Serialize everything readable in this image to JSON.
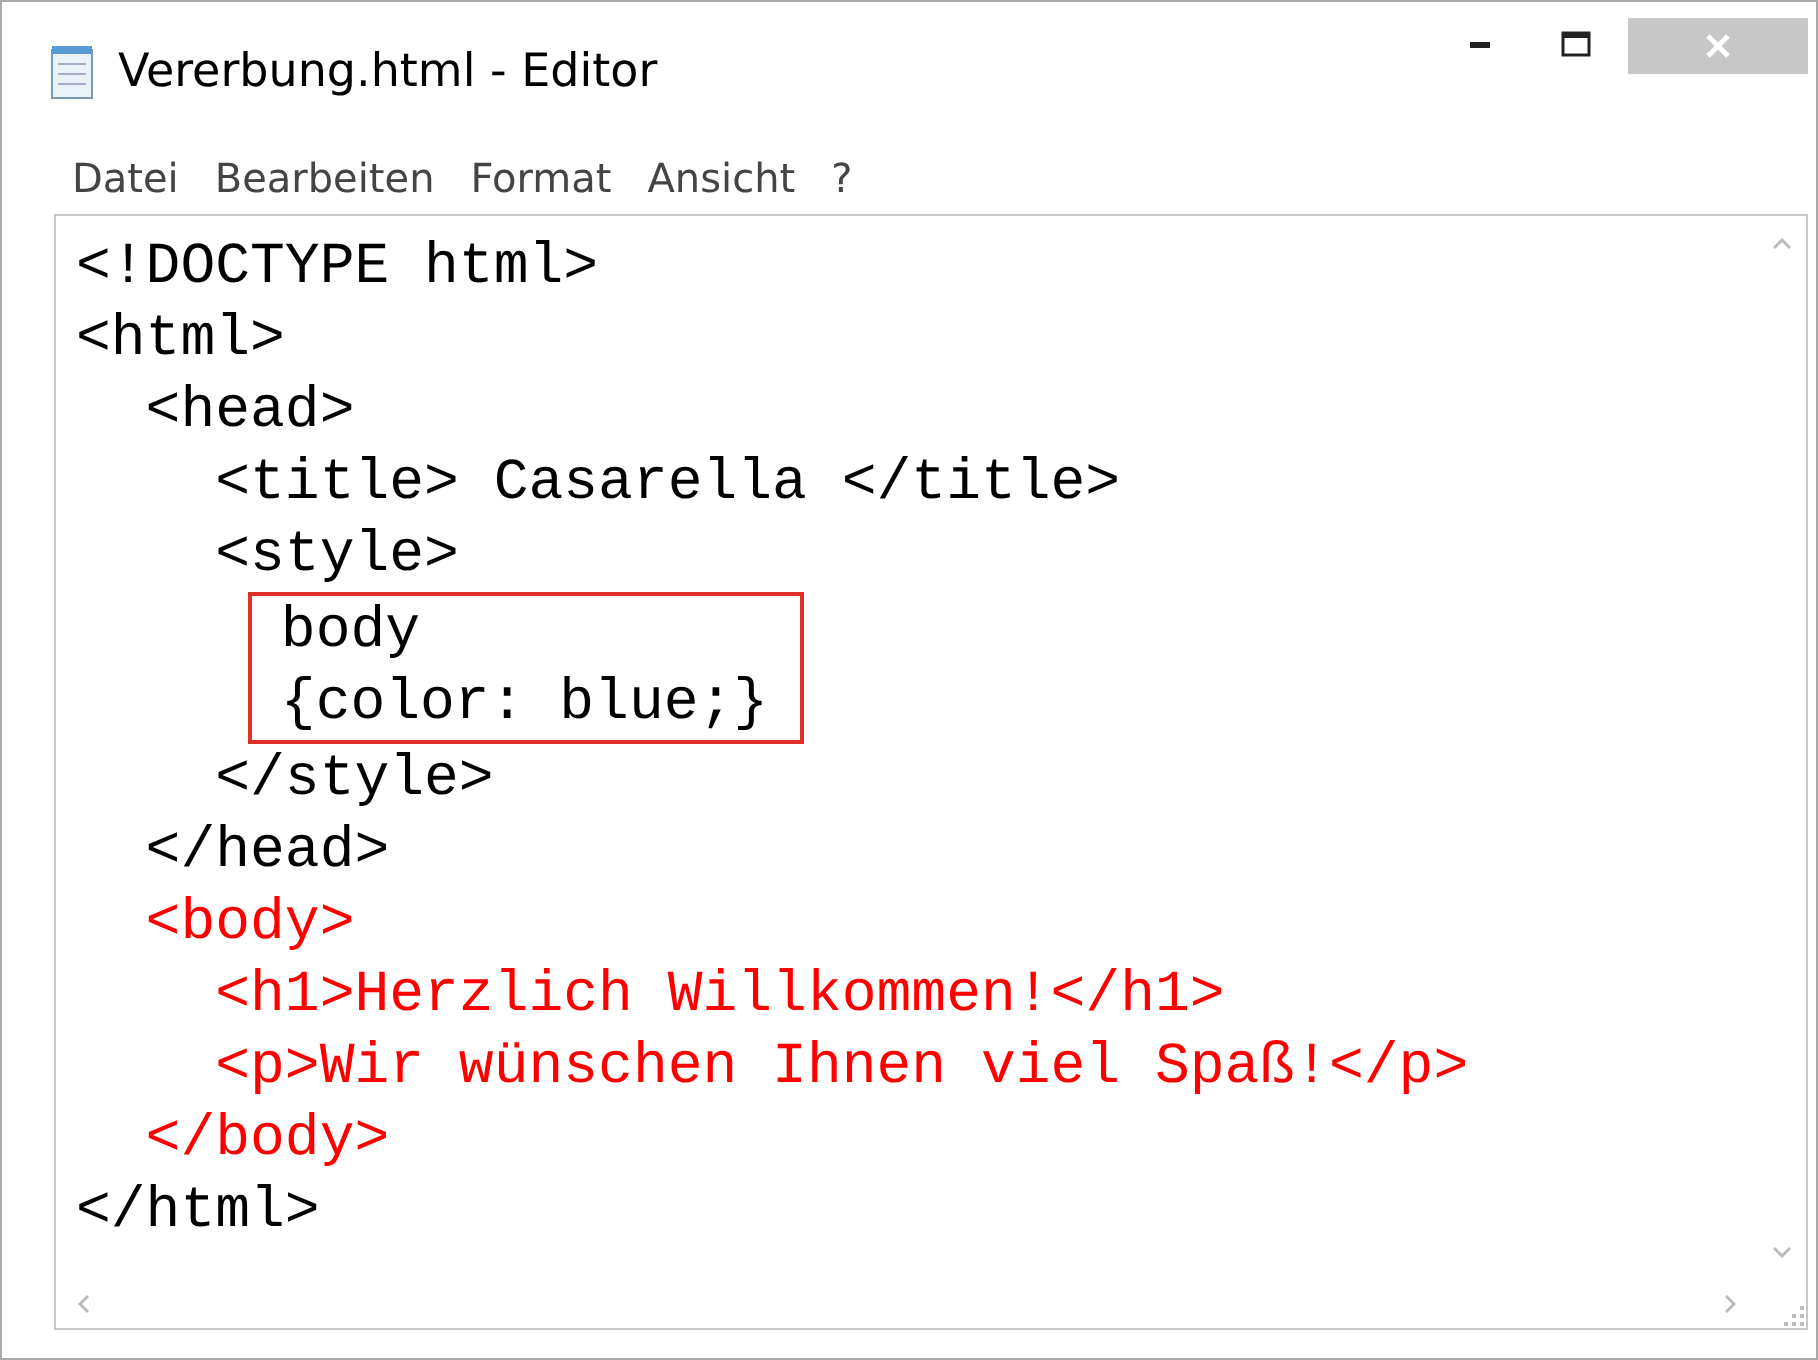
{
  "window": {
    "title": "Vererbung.html - Editor"
  },
  "menu": [
    "Datei",
    "Bearbeiten",
    "Format",
    "Ansicht",
    "?"
  ],
  "lines": [
    {
      "text": "<!DOCTYPE html>",
      "color": "#000000",
      "highlighted": false
    },
    {
      "text": "<html>",
      "color": "#000000",
      "highlighted": false
    },
    {
      "text": "  <head>",
      "color": "#000000",
      "highlighted": false
    },
    {
      "text": "    <title> Casarella </title>",
      "color": "#000000",
      "highlighted": false
    },
    {
      "text": "    <style>",
      "color": "#000000",
      "highlighted": false
    },
    {
      "text": "      body",
      "color": "#000000",
      "highlighted": true
    },
    {
      "text": "      {color: blue;}",
      "color": "#000000",
      "highlighted": true
    },
    {
      "text": "    </style>",
      "color": "#000000",
      "highlighted": false
    },
    {
      "text": "  </head>",
      "color": "#000000",
      "highlighted": false
    },
    {
      "text": "  <body>",
      "color": "#ff0000",
      "highlighted": false
    },
    {
      "text": "    <h1>Herzlich Willkommen!</h1>",
      "color": "#ff0000",
      "highlighted": false
    },
    {
      "text": "    <p>Wir wünschen Ihnen viel Spaß!</p>",
      "color": "#ff0000",
      "highlighted": false
    },
    {
      "text": "  </body>",
      "color": "#ff0000",
      "highlighted": false
    },
    {
      "text": "</html>",
      "color": "#000000",
      "highlighted": false
    }
  ]
}
